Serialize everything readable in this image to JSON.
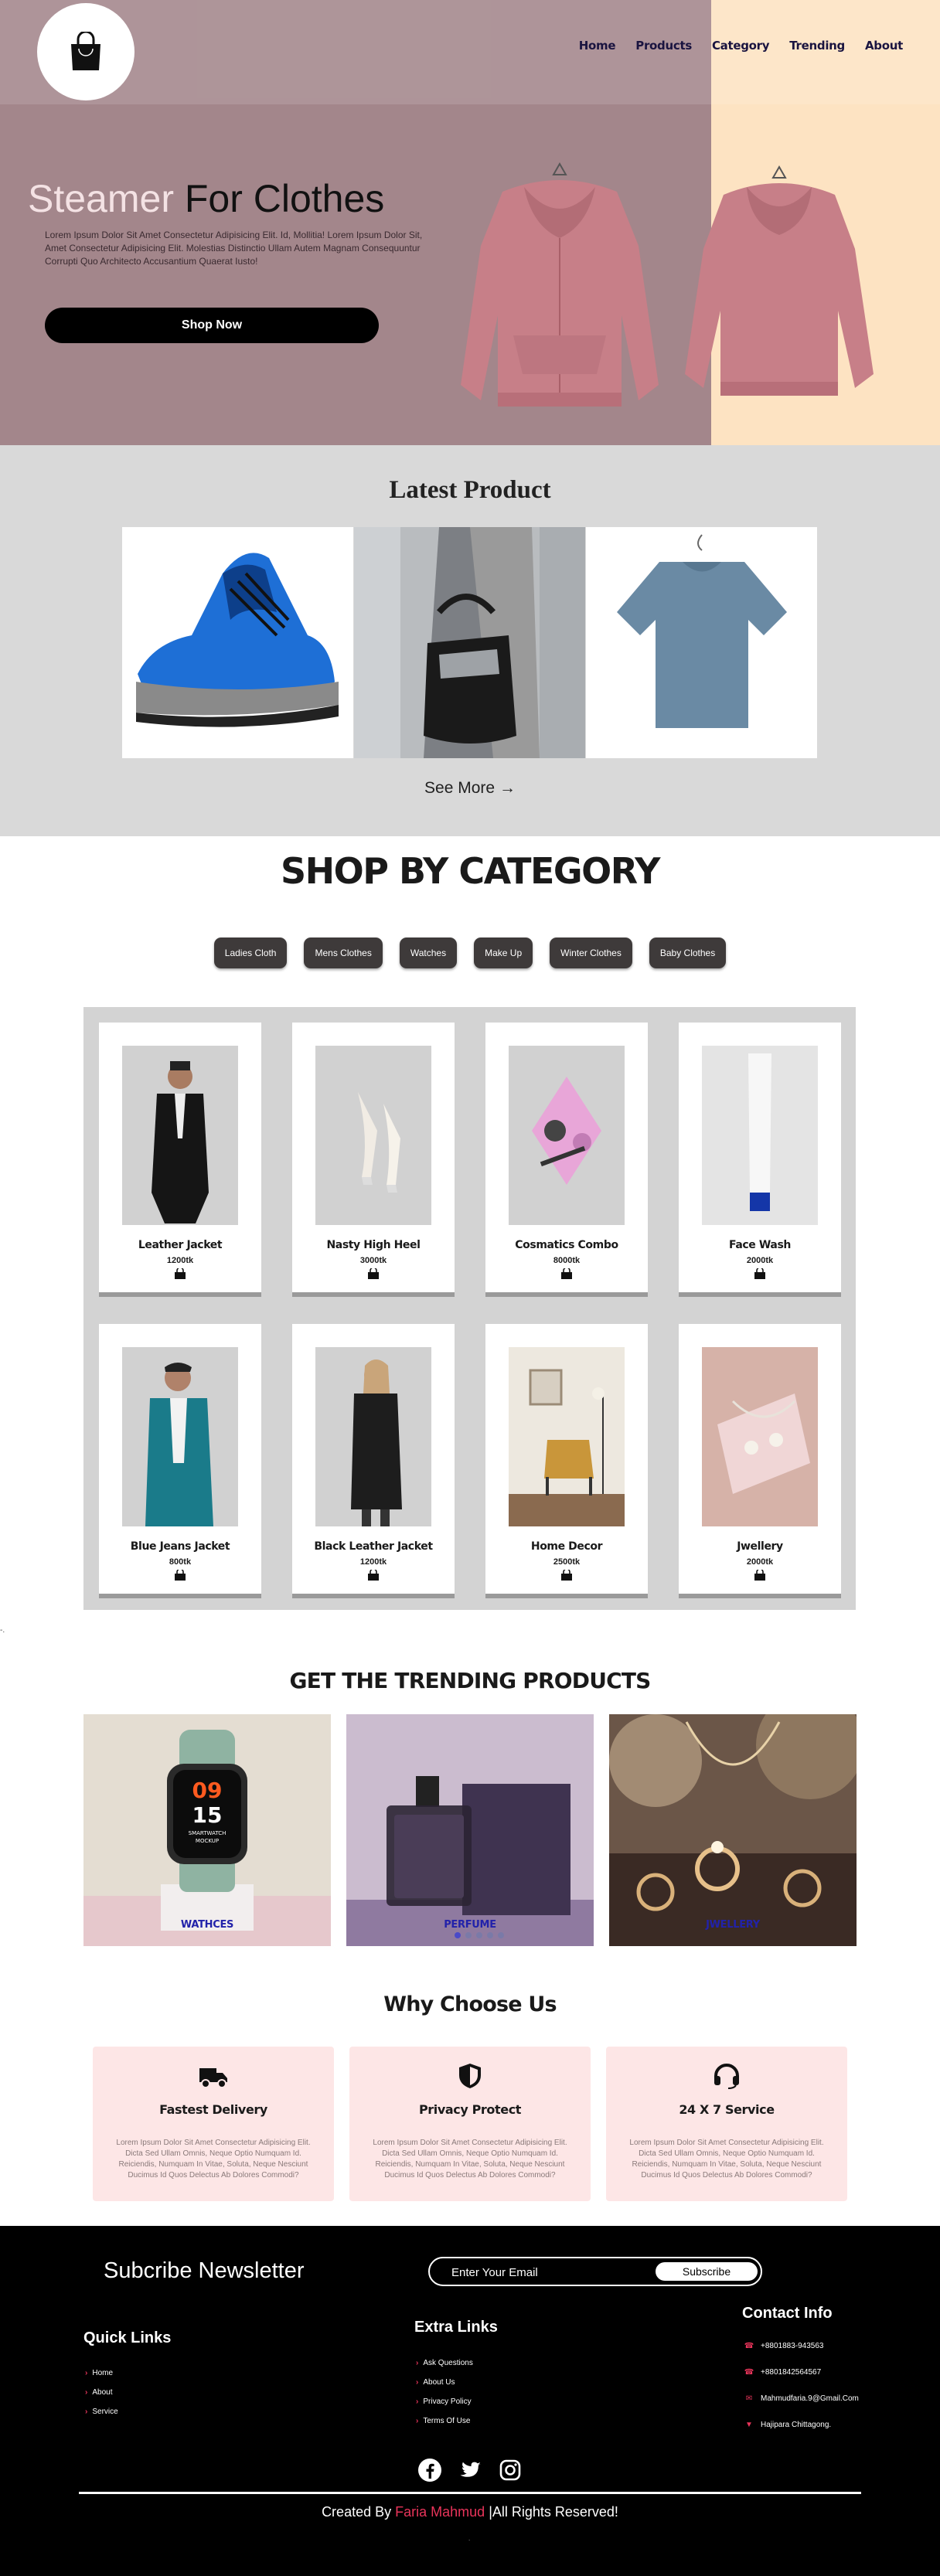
{
  "nav": {
    "links": [
      "Home",
      "Products",
      "Category",
      "Trending",
      "About"
    ]
  },
  "hero": {
    "title_accent": "Steamer",
    "title_rest": "For Clothes",
    "description": "Lorem Ipsum Dolor Sit Amet Consectetur Adipisicing Elit. Id, Mollitia! Lorem Ipsum Dolor Sit, Amet Consectetur Adipisicing Elit. Molestias Distinctio Ullam Autem Magnam Consequuntur Corrupti Quo Architecto Accusantium Quaerat Iusto!",
    "button_label": "Shop Now"
  },
  "latest": {
    "title": "Latest Product",
    "see_more_label": "See More"
  },
  "category": {
    "title": "SHOP BY CATEGORY",
    "pills": [
      "Ladies Cloth",
      "Mens Clothes",
      "Watches",
      "Make Up",
      "Winter Clothes",
      "Baby Clothes"
    ],
    "products": [
      {
        "name": "Leather Jacket",
        "price": "1200tk"
      },
      {
        "name": "Nasty High Heel",
        "price": "3000tk"
      },
      {
        "name": "Cosmatics Combo",
        "price": "8000tk"
      },
      {
        "name": "Face Wash",
        "price": "2000tk"
      },
      {
        "name": "Blue Jeans Jacket",
        "price": "800tk"
      },
      {
        "name": "Black Leather Jacket",
        "price": "1200tk"
      },
      {
        "name": "Home Decor",
        "price": "2500tk"
      },
      {
        "name": "Jwellery",
        "price": "2000tk"
      }
    ]
  },
  "stray_text": "-.",
  "trending": {
    "title": "GET THE TRENDING PRODUCTS",
    "items": [
      {
        "label": "WATHCES"
      },
      {
        "label": "PERFUME"
      },
      {
        "label": "JWELLERY"
      }
    ],
    "watch_hour": "09",
    "watch_minute": "15",
    "watch_mock_line1": "SMARTWATCH",
    "watch_mock_line2": "MOCKUP"
  },
  "why": {
    "title": "Why Choose Us",
    "cards": [
      {
        "icon": "truck-icon",
        "title": "Fastest Delivery",
        "text": "Lorem Ipsum Dolor Sit Amet Consectetur Adipisicing Elit. Dicta Sed Ullam Omnis, Neque Optio Numquam Id. Reiciendis, Numquam In Vitae, Soluta, Neque Nesciunt Ducimus Id Quos Delectus Ab Dolores Commodi?"
      },
      {
        "icon": "shield-icon",
        "title": "Privacy Protect",
        "text": "Lorem Ipsum Dolor Sit Amet Consectetur Adipisicing Elit. Dicta Sed Ullam Omnis, Neque Optio Numquam Id. Reiciendis, Numquam In Vitae, Soluta, Neque Nesciunt Ducimus Id Quos Delectus Ab Dolores Commodi?"
      },
      {
        "icon": "headset-icon",
        "title": "24 X 7 Service",
        "text": "Lorem Ipsum Dolor Sit Amet Consectetur Adipisicing Elit. Dicta Sed Ullam Omnis, Neque Optio Numquam Id. Reiciendis, Numquam In Vitae, Soluta, Neque Nesciunt Ducimus Id Quos Delectus Ab Dolores Commodi?"
      }
    ]
  },
  "footer": {
    "newsletter_title": "Subcribe Newsletter",
    "email_placeholder": "Enter Your Email",
    "subscribe_label": "Subscribe",
    "quick_links_title": "Quick Links",
    "quick_links": [
      "Home",
      "About",
      "Service"
    ],
    "extra_links_title": "Extra Links",
    "extra_links": [
      "Ask Questions",
      "About Us",
      "Privacy Policy",
      "Terms Of Use"
    ],
    "contact_title": "Contact Info",
    "contacts": [
      {
        "icon": "phone-icon",
        "text": "+8801883-943563"
      },
      {
        "icon": "phone-icon",
        "text": "+8801842564567"
      },
      {
        "icon": "mail-icon",
        "text": "Mahmudfaria.9@Gmail.Com"
      },
      {
        "icon": "location-icon",
        "text": "Hajipara Chittagong."
      }
    ],
    "social": [
      "facebook-icon",
      "twitter-icon",
      "instagram-icon"
    ],
    "credit_prefix": "Created By",
    "credit_name": "Faria Mahmud",
    "credit_suffix": "|All Rights Reserved!",
    "mini_text": "."
  },
  "colors": {
    "hero_bg": "#a3868b",
    "hero_right_panel": "#fde3c2",
    "accent_pink": "#e8345a",
    "card_pink": "#fde6e6",
    "trend_label": "#2222aa"
  }
}
